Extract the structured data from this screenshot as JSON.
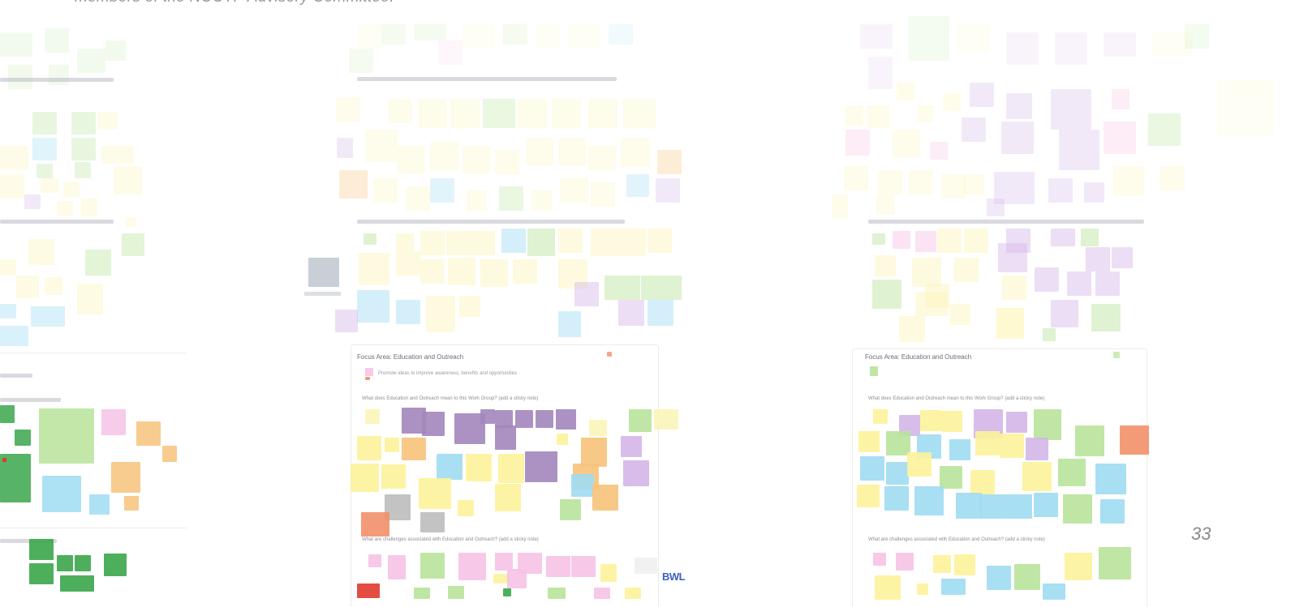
{
  "caption": "members of the NCCTP Advisory Committee.",
  "page_number": "33",
  "boards": [
    {
      "id": "left",
      "focus_title": "",
      "focus_subtitle": "",
      "question_1": "",
      "question_2": ""
    },
    {
      "id": "center",
      "focus_title": "Focus Area: Education and Outreach",
      "focus_subtitle": "Promote ideas to improve awareness, benefits and opportunities",
      "question_1": "What does Education and Outreach mean to this Work Group? (add a sticky note)",
      "question_2": "What are challenges associated with Education and Outreach? (add a sticky note)",
      "logo": "BWL"
    },
    {
      "id": "right",
      "focus_title": "Focus Area: Education and Outreach",
      "focus_subtitle": "",
      "question_1": "What does Education and Outreach mean to this Work Group? (add a sticky note)",
      "question_2": "What are challenges associated with Education and Outreach? (add a sticky note)"
    }
  ],
  "colors": {
    "yellow": "#fdf29a",
    "lightyellow": "#fbf5b8",
    "green": "#b8e39a",
    "darkgreen": "#3aa64a",
    "blue": "#9fdcf2",
    "purple": "#d4b6e8",
    "darkpurple": "#a386bd",
    "pink": "#f6c2e6",
    "orange": "#f7c27a",
    "red": "#e03a2e",
    "salmon": "#f2906a",
    "gray": "#bdbdbd"
  }
}
